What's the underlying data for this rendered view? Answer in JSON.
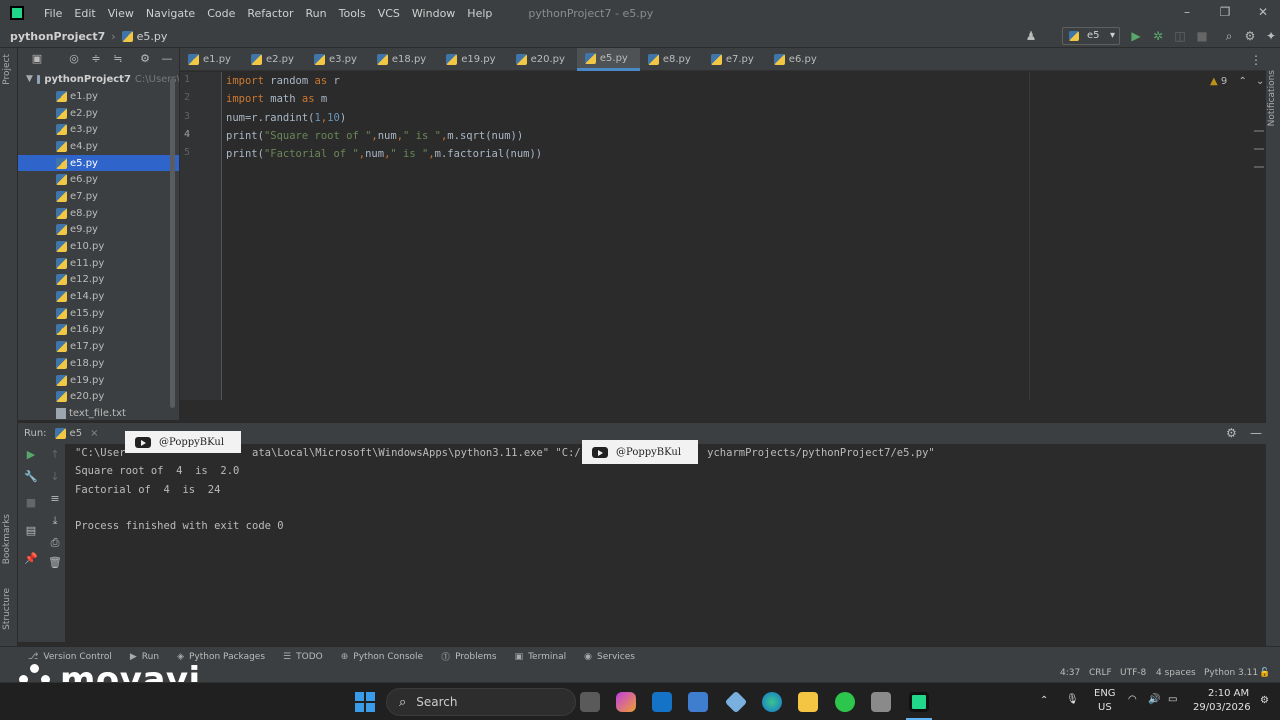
{
  "menubar": {
    "items": [
      "File",
      "Edit",
      "View",
      "Navigate",
      "Code",
      "Refactor",
      "Run",
      "Tools",
      "VCS",
      "Window",
      "Help"
    ],
    "window_title": "pythonProject7 - e5.py"
  },
  "navbar": {
    "project": "pythonProject7",
    "file": "e5.py",
    "run_config": "e5"
  },
  "project_panel": {
    "root_name": "pythonProject7",
    "root_path": "C:\\Users\\",
    "files": [
      "e1.py",
      "e2.py",
      "e3.py",
      "e4.py",
      "e5.py",
      "e6.py",
      "e7.py",
      "e8.py",
      "e9.py",
      "e10.py",
      "e11.py",
      "e12.py",
      "e14.py",
      "e15.py",
      "e16.py",
      "e17.py",
      "e18.py",
      "e19.py",
      "e20.py",
      "text_file.txt"
    ],
    "selected": "e5.py"
  },
  "left_strip": {
    "project_label": "Project",
    "bookmarks_label": "Bookmarks",
    "structure_label": "Structure"
  },
  "right_strip": {
    "notifications_label": "Notifications"
  },
  "editor": {
    "tabs": [
      "e1.py",
      "e2.py",
      "e3.py",
      "e18.py",
      "e19.py",
      "e20.py",
      "e5.py",
      "e8.py",
      "e7.py",
      "e6.py"
    ],
    "active_tab": "e5.py",
    "line_numbers": [
      "1",
      "2",
      "3",
      "4",
      "5"
    ],
    "current_line": "4",
    "warning_count": "9",
    "lines": [
      [
        {
          "t": "import",
          "c": "kw"
        },
        {
          "t": " random ",
          "c": "fn"
        },
        {
          "t": "as",
          "c": "kw"
        },
        {
          "t": " r",
          "c": "fn"
        }
      ],
      [
        {
          "t": "import",
          "c": "kw"
        },
        {
          "t": " math ",
          "c": "fn"
        },
        {
          "t": "as",
          "c": "kw"
        },
        {
          "t": " m",
          "c": "fn"
        }
      ],
      [
        {
          "t": "num=r.randint(",
          "c": "fn"
        },
        {
          "t": "1",
          "c": "num"
        },
        {
          "t": ",",
          "c": "kw"
        },
        {
          "t": "10",
          "c": "num"
        },
        {
          "t": ")",
          "c": "fn"
        }
      ],
      [
        {
          "t": "print(",
          "c": "fn"
        },
        {
          "t": "\"Square root of \"",
          "c": "str"
        },
        {
          "t": ",",
          "c": "kw"
        },
        {
          "t": "num",
          "c": "fn"
        },
        {
          "t": ",",
          "c": "kw"
        },
        {
          "t": "\" is \"",
          "c": "str"
        },
        {
          "t": ",",
          "c": "kw"
        },
        {
          "t": "m.sqrt(num))",
          "c": "fn"
        }
      ],
      [
        {
          "t": "print(",
          "c": "fn"
        },
        {
          "t": "\"Factorial of \"",
          "c": "str"
        },
        {
          "t": ",",
          "c": "kw"
        },
        {
          "t": "num",
          "c": "fn"
        },
        {
          "t": ",",
          "c": "kw"
        },
        {
          "t": "\" is \"",
          "c": "str"
        },
        {
          "t": ",",
          "c": "kw"
        },
        {
          "t": "m.factorial(num))",
          "c": "fn"
        }
      ]
    ]
  },
  "run_panel": {
    "label": "Run:",
    "tab": "e5",
    "console_lines": [
      "\"C:\\User                    ata\\Local\\Microsoft\\WindowsApps\\python3.11.exe\" \"C:/                    ycharmProjects/pythonProject7/e5.py\"",
      "Square root of  4  is  2.0",
      "Factorial of  4  is  24",
      "",
      "Process finished with exit code 0"
    ]
  },
  "watermarks": [
    "@PoppyBKul",
    "@PoppyBKul"
  ],
  "tool_windows": [
    "Version Control",
    "Run",
    "Python Packages",
    "TODO",
    "Python Console",
    "Problems",
    "Terminal",
    "Services"
  ],
  "status_bar": {
    "position": "4:37",
    "line_sep": "CRLF",
    "encoding": "UTF-8",
    "indent": "4 spaces",
    "interpreter": "Python 3.11"
  },
  "overlay": {
    "brand": "movavi"
  },
  "taskbar": {
    "search_label": "Search",
    "lang_top": "ENG",
    "lang_bottom": "US",
    "time": "2:10 AM",
    "date": "29/03/2026"
  },
  "colors": {
    "accent": "#2f65ca",
    "run_green": "#59a869",
    "keyword": "#cc7832",
    "string": "#6a8759",
    "number": "#6897bb"
  }
}
